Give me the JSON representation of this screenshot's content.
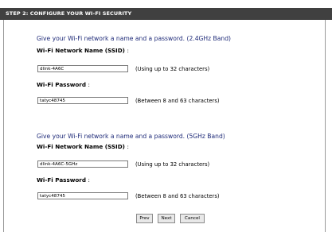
{
  "header": {
    "title": "STEP 2: CONFIGURE YOUR WI-FI SECURITY"
  },
  "band_24": {
    "title": "Give your Wi-Fi network a name and a password. (2.4GHz Band)",
    "ssid_label": "Wi-Fi Network Name (SSID)",
    "ssid_value": "dlink-4A6C",
    "ssid_hint": "(Using up to 32 characters)",
    "password_label": "Wi-Fi Password",
    "password_value": "tatyc48745",
    "password_hint": "(Between 8 and 63 characters)"
  },
  "band_5": {
    "title": "Give your Wi-Fi network a name and a password. (5GHz Band)",
    "ssid_label": "Wi-Fi Network Name (SSID)",
    "ssid_value": "dlink-4A6C-5GHz",
    "ssid_hint": "(Using up to 32 characters)",
    "password_label": "Wi-Fi Password",
    "password_value": "tatyc48745",
    "password_hint": "(Between 8 and 63 characters)"
  },
  "colon": ":",
  "buttons": {
    "prev": "Prev",
    "next": "Next",
    "cancel": "Cancel"
  },
  "colors": {
    "header_bg": "#404040",
    "band_title": "#1e2a78",
    "frame_border": "#9a9a9a"
  }
}
